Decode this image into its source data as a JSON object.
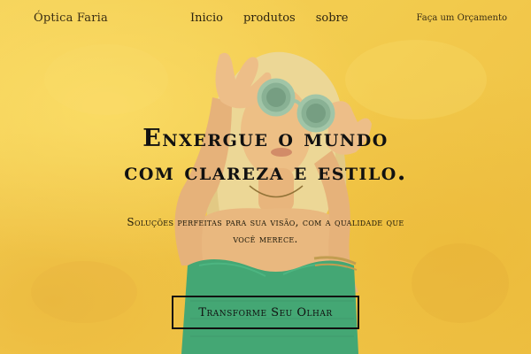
{
  "nav": {
    "brand": "Óptica Faria",
    "links": [
      "Inicio",
      "produtos",
      "sobre"
    ],
    "cta": "Faça um Orçamento"
  },
  "hero": {
    "headline_line1": "Enxergue o mundo",
    "headline_line2": "com clareza e estilo.",
    "subtitle_line1": "Soluções perfeitas para sua visão, com a qualidade que",
    "subtitle_line2": "você merece.",
    "button": "Transforme Seu Olhar",
    "image": "woman-with-round-sunglasses"
  },
  "colors": {
    "background": "#f0c94a",
    "text": "#111111",
    "top": "#1b9b7a"
  }
}
